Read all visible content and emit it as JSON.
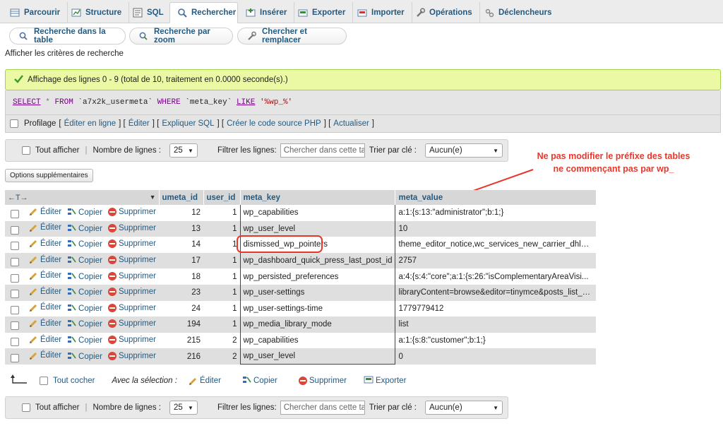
{
  "tabs": [
    {
      "label": "Parcourir",
      "icon": "browse-icon"
    },
    {
      "label": "Structure",
      "icon": "structure-icon"
    },
    {
      "label": "SQL",
      "icon": "sql-icon"
    },
    {
      "label": "Rechercher",
      "icon": "search-icon",
      "active": true
    },
    {
      "label": "Insérer",
      "icon": "insert-icon"
    },
    {
      "label": "Exporter",
      "icon": "export-icon"
    },
    {
      "label": "Importer",
      "icon": "import-icon"
    },
    {
      "label": "Opérations",
      "icon": "wrench-icon"
    },
    {
      "label": "Déclencheurs",
      "icon": "triggers-icon"
    }
  ],
  "subtabs": [
    {
      "label": "Recherche dans la table"
    },
    {
      "label": "Recherche par zoom"
    },
    {
      "label": "Chercher et remplacer"
    }
  ],
  "search_criteria_label": "Afficher les critères de recherche",
  "success_message": "Affichage des lignes 0 - 9 (total de 10, traitement en 0.0000 seconde(s).)",
  "sql": {
    "select": "SELECT",
    "star": "*",
    "from": "FROM",
    "table": "`a7x2k_usermeta`",
    "where": "WHERE",
    "column": "`meta_key`",
    "like": "LIKE",
    "pattern": "'%wp_%'"
  },
  "profiling": {
    "label": "Profilage",
    "links": [
      "Éditer en ligne",
      "Éditer",
      "Expliquer SQL",
      "Créer le code source PHP",
      "Actualiser"
    ]
  },
  "nav": {
    "show_all": "Tout afficher",
    "row_count_label": "Nombre de lignes :",
    "row_count_value": "25",
    "filter_label": "Filtrer les lignes:",
    "filter_placeholder": "Chercher dans cette table",
    "sort_label": "Trier par clé :",
    "sort_value": "Aucun(e)"
  },
  "extra_options_label": "Options supplémentaires",
  "annotation": {
    "line1": "Ne pas modifier le préfixe des tables",
    "line2": "ne commençant pas par wp_",
    "color": "#e8372a"
  },
  "table": {
    "columns": [
      "umeta_id",
      "user_id",
      "meta_key",
      "meta_value"
    ],
    "actions": {
      "edit": "Éditer",
      "copy": "Copier",
      "delete": "Supprimer"
    },
    "rows": [
      {
        "umeta_id": "12",
        "user_id": "1",
        "meta_key": "wp_capabilities",
        "meta_value": "a:1:{s:13:\"administrator\";b:1;}"
      },
      {
        "umeta_id": "13",
        "user_id": "1",
        "meta_key": "wp_user_level",
        "meta_value": "10"
      },
      {
        "umeta_id": "14",
        "user_id": "1",
        "meta_key": "dismissed_wp_pointers",
        "meta_value": "theme_editor_notice,wc_services_new_carrier_dhl_ex..."
      },
      {
        "umeta_id": "17",
        "user_id": "1",
        "meta_key": "wp_dashboard_quick_press_last_post_id",
        "meta_value": "2757"
      },
      {
        "umeta_id": "18",
        "user_id": "1",
        "meta_key": "wp_persisted_preferences",
        "meta_value": "a:4:{s:4:\"core\";a:1:{s:26:\"isComplementaryAreaVisi..."
      },
      {
        "umeta_id": "23",
        "user_id": "1",
        "meta_key": "wp_user-settings",
        "meta_value": "libraryContent=browse&editor=tinymce&posts_list_mo..."
      },
      {
        "umeta_id": "24",
        "user_id": "1",
        "meta_key": "wp_user-settings-time",
        "meta_value": "1779779412"
      },
      {
        "umeta_id": "194",
        "user_id": "1",
        "meta_key": "wp_media_library_mode",
        "meta_value": "list"
      },
      {
        "umeta_id": "215",
        "user_id": "2",
        "meta_key": "wp_capabilities",
        "meta_value": "a:1:{s:8:\"customer\";b:1;}"
      },
      {
        "umeta_id": "216",
        "user_id": "2",
        "meta_key": "wp_user_level",
        "meta_value": "0"
      }
    ]
  },
  "bottom": {
    "check_all": "Tout cocher",
    "with_selection": "Avec la sélection :",
    "edit": "Éditer",
    "copy": "Copier",
    "delete": "Supprimer",
    "export": "Exporter"
  }
}
